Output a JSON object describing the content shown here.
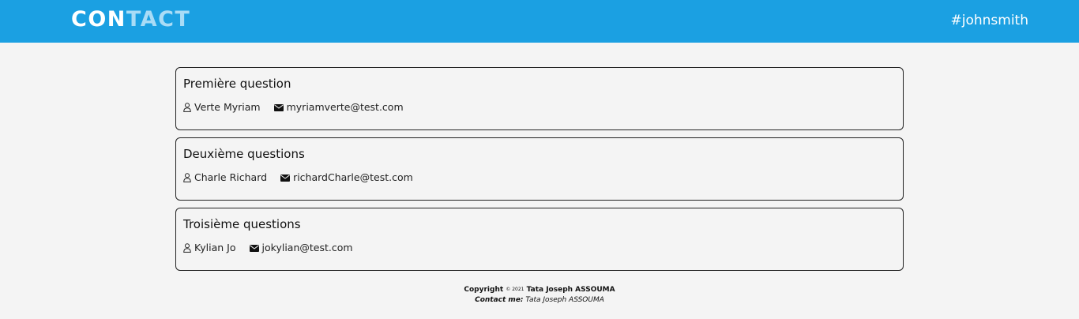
{
  "header": {
    "logo_part1": "CON",
    "logo_part2": "TACT",
    "user_tag": "#johnsmith",
    "background": "#1ba0e2"
  },
  "cards": [
    {
      "title": "Première question",
      "author": "Verte Myriam",
      "email": "myriamverte@test.com"
    },
    {
      "title": "Deuxième questions",
      "author": "Charle Richard",
      "email": "richardCharle@test.com"
    },
    {
      "title": "Troisième questions",
      "author": "Kylian Jo",
      "email": "jokylian@test.com"
    }
  ],
  "icons": {
    "author": "user-icon",
    "email": "envelope-icon"
  },
  "footer": {
    "copyright_label": "Copyright",
    "copyright_symbol_year": "© 2021",
    "copyright_name": "Tata Joseph ASSOUMA",
    "contact_label": "Contact me:",
    "contact_name": "Tata Joseph ASSOUMA"
  }
}
